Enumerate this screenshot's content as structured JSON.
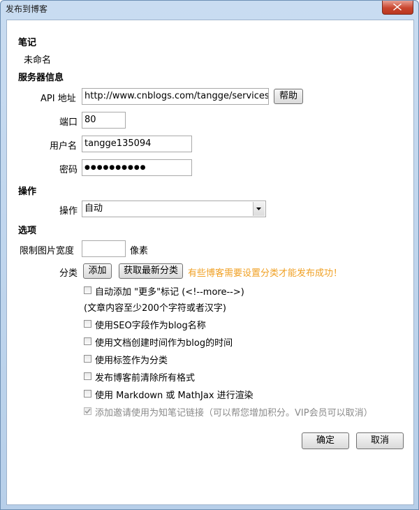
{
  "window": {
    "title": "发布到博客"
  },
  "note": {
    "heading": "笔记",
    "name": "未命名"
  },
  "server": {
    "heading": "服务器信息",
    "api_label": "API 地址",
    "api_value": "http://www.cnblogs.com/tangge/services/metablogapi.aspx",
    "help_label": "帮助",
    "port_label": "端口",
    "port_value": "80",
    "user_label": "用户名",
    "user_value": "tangge135094",
    "password_label": "密码",
    "password_value": "●●●●●●●●●●"
  },
  "operation": {
    "heading": "操作",
    "label": "操作",
    "selected": "自动"
  },
  "options": {
    "heading": "选项",
    "img_width_label": "限制图片宽度",
    "img_width_value": "",
    "img_unit": "像素",
    "category_label": "分类",
    "add_label": "添加",
    "fetch_label": "获取最新分类",
    "category_warning": "有些博客需要设置分类才能发布成功！",
    "checkboxes": [
      {
        "label": "自动添加 \"更多\"标记 (<!--more-->)",
        "checked": false,
        "enabled": true
      },
      {
        "label": "使用SEO字段作为blog名称",
        "checked": false,
        "enabled": true
      },
      {
        "label": "使用文档创建时间作为blog的时间",
        "checked": false,
        "enabled": true
      },
      {
        "label": "使用标签作为分类",
        "checked": false,
        "enabled": true
      },
      {
        "label": "发布博客前清除所有格式",
        "checked": false,
        "enabled": true
      },
      {
        "label": "使用 Markdown 或 MathJax 进行渲染",
        "checked": false,
        "enabled": true
      },
      {
        "label": "添加邀请使用为知笔记链接（可以帮您增加积分。VIP会员可以取消）",
        "checked": true,
        "enabled": false
      }
    ],
    "more_note": "(文章内容至少200个字符或者汉字)"
  },
  "footer": {
    "ok_label": "确定",
    "cancel_label": "取消"
  }
}
